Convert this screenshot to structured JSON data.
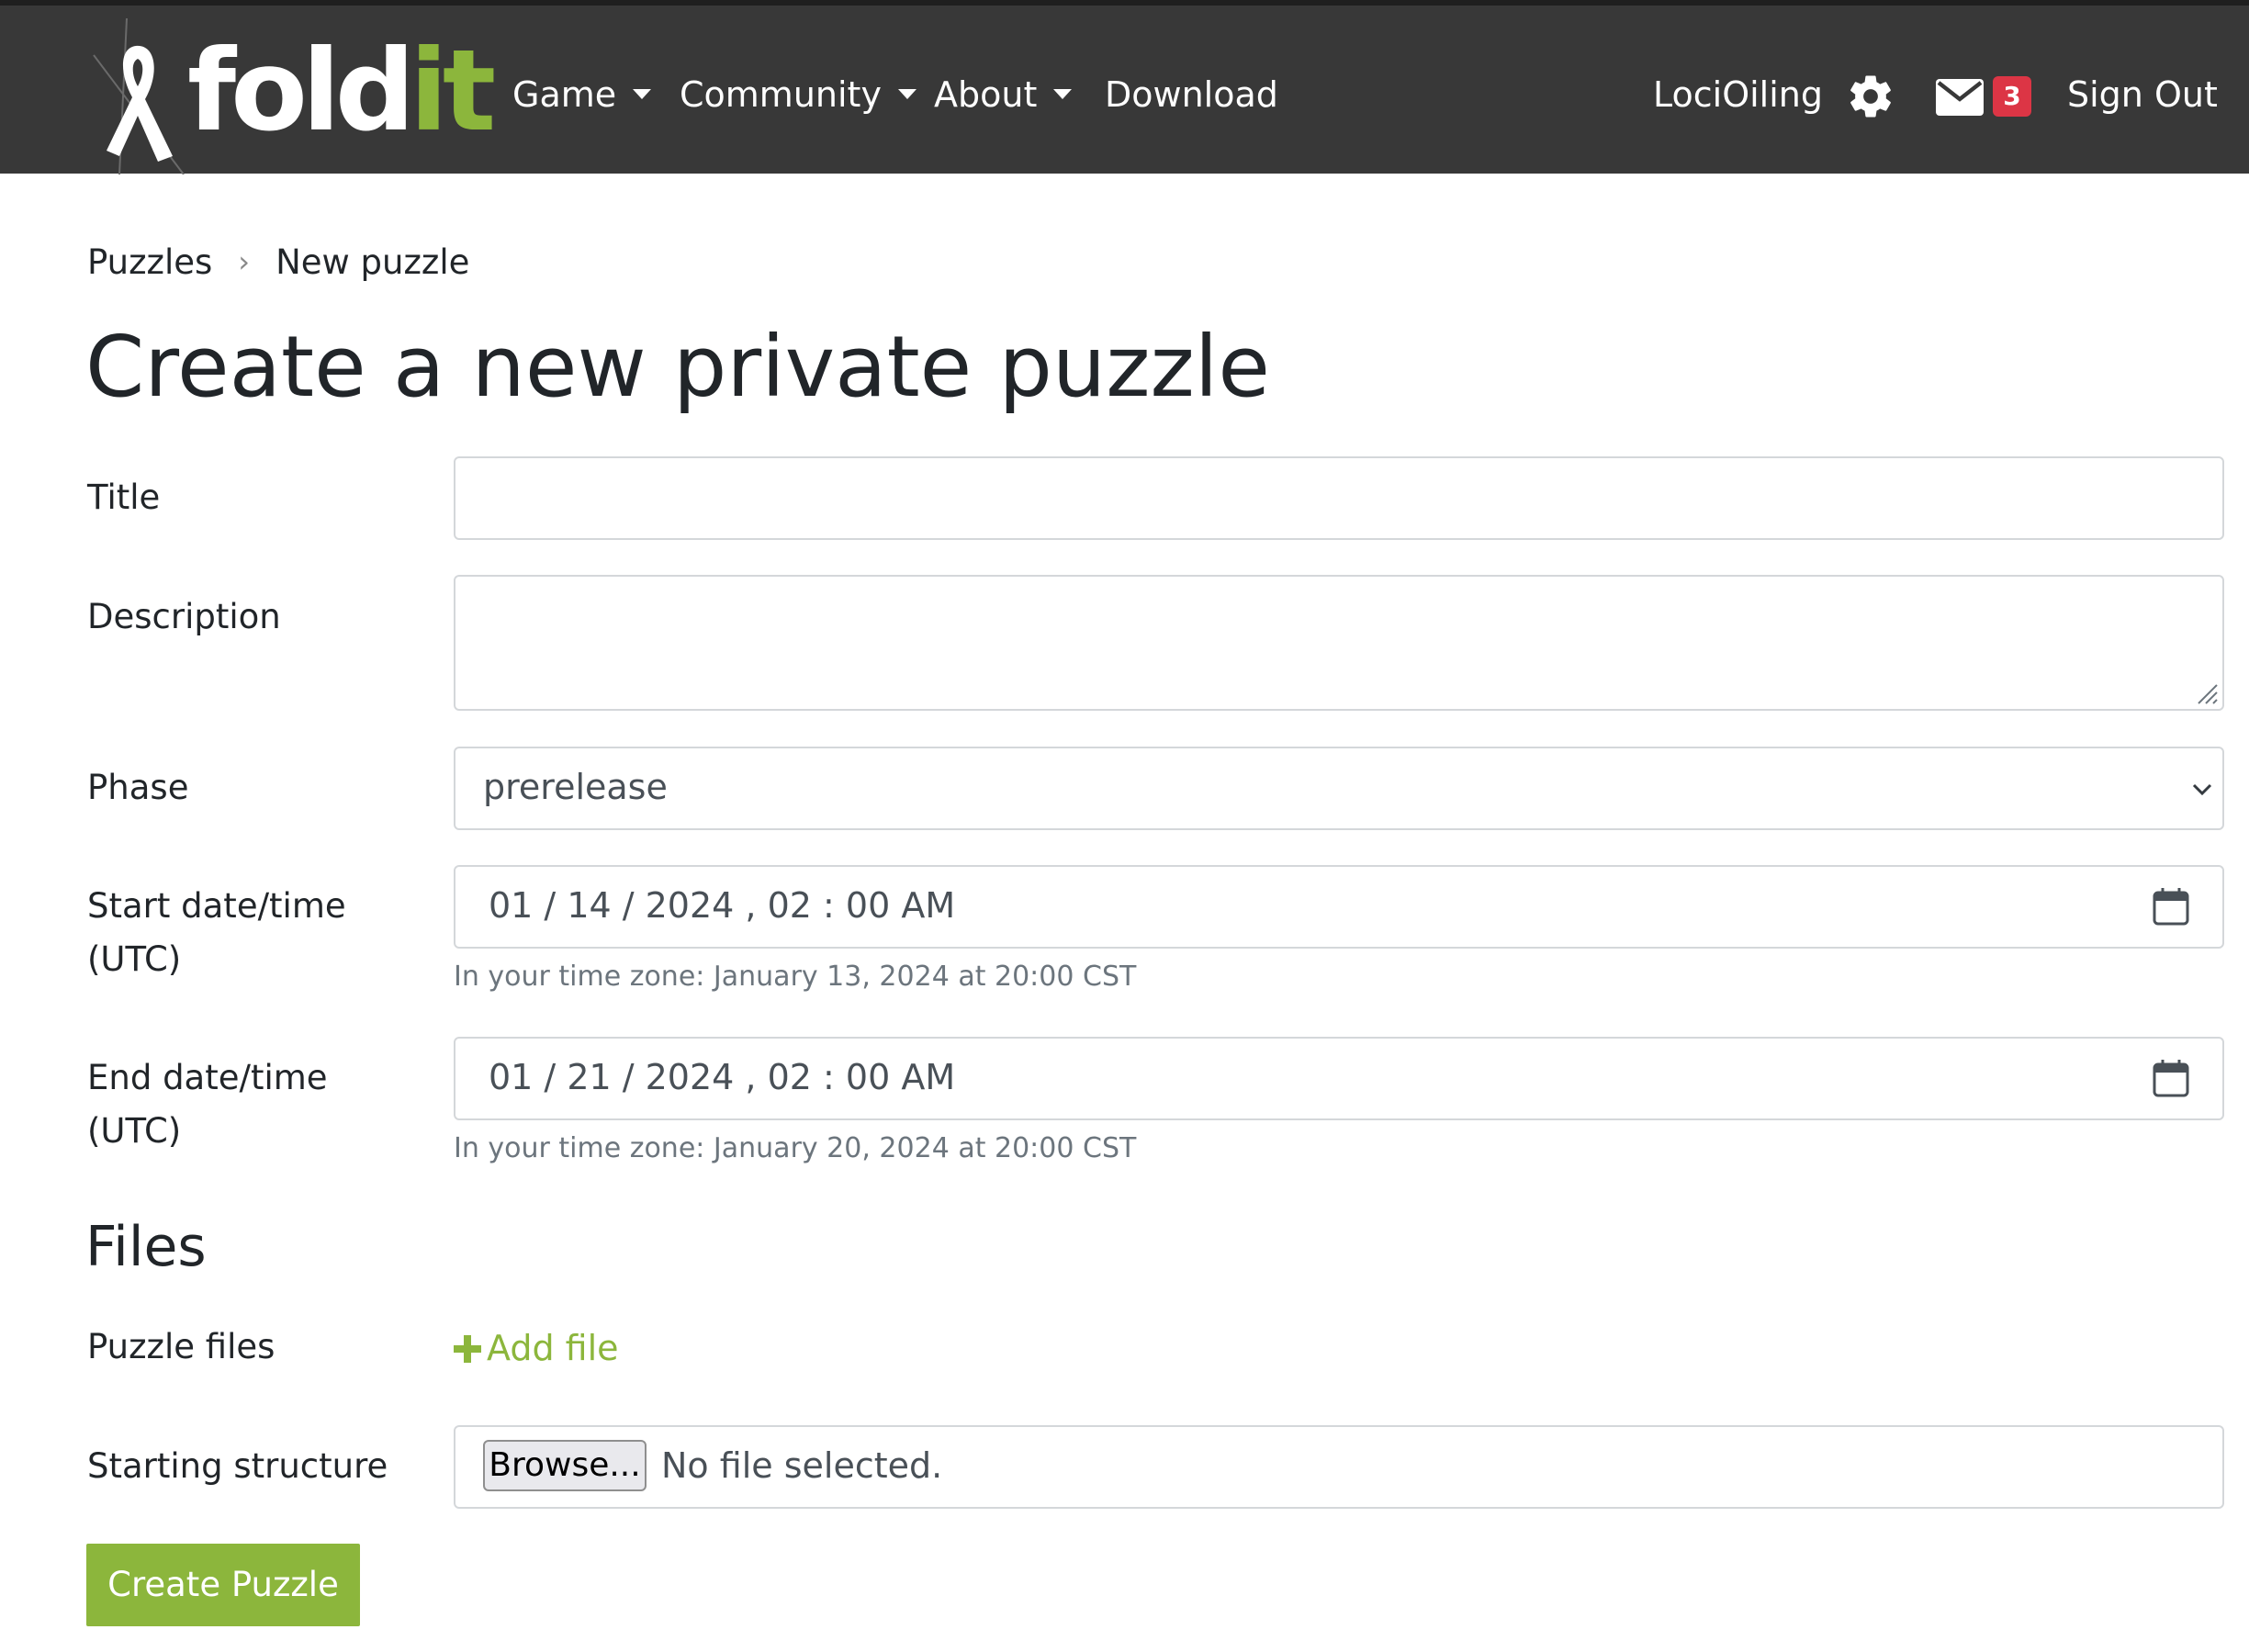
{
  "nav": {
    "logo_word": "fold",
    "logo_word_green": "it",
    "menu": [
      {
        "label": "Game"
      },
      {
        "label": "Community"
      },
      {
        "label": "About"
      },
      {
        "label": "Download"
      }
    ],
    "username": "LociOiling",
    "settings_icon": "gear-icon",
    "mail_icon": "envelope-icon",
    "mail_count": "3",
    "sign_out": "Sign Out"
  },
  "breadcrumb": {
    "parent": "Puzzles",
    "separator": "›",
    "current": "New puzzle"
  },
  "page_title": "Create a new private puzzle",
  "form": {
    "title_label": "Title",
    "title_value": "",
    "description_label": "Description",
    "description_value": "",
    "phase_label": "Phase",
    "phase_value": "prerelease",
    "start_label_line1": "Start date/time",
    "start_label_line2": "(UTC)",
    "start_value": "01 / 14 / 2024 ,  02 : 00   AM",
    "start_help": "In your time zone: January 13, 2024 at 20:00 CST",
    "end_label_line1": "End date/time",
    "end_label_line2": "(UTC)",
    "end_value": "01 / 21 / 2024 ,  02 : 00   AM",
    "end_help": "In your time zone: January 20, 2024 at 20:00 CST",
    "calendar_icon": "calendar-icon"
  },
  "files": {
    "heading": "Files",
    "puzzle_files_label": "Puzzle files",
    "add_file_icon": "plus-icon",
    "add_file_label": "Add file",
    "starting_structure_label": "Starting structure",
    "browse_label": "Browse...",
    "no_file_text": "No file selected."
  },
  "submit_label": "Create Puzzle",
  "colors": {
    "navbar": "#383838",
    "accent_green": "#8cb63c",
    "badge_red": "#dc3545"
  }
}
